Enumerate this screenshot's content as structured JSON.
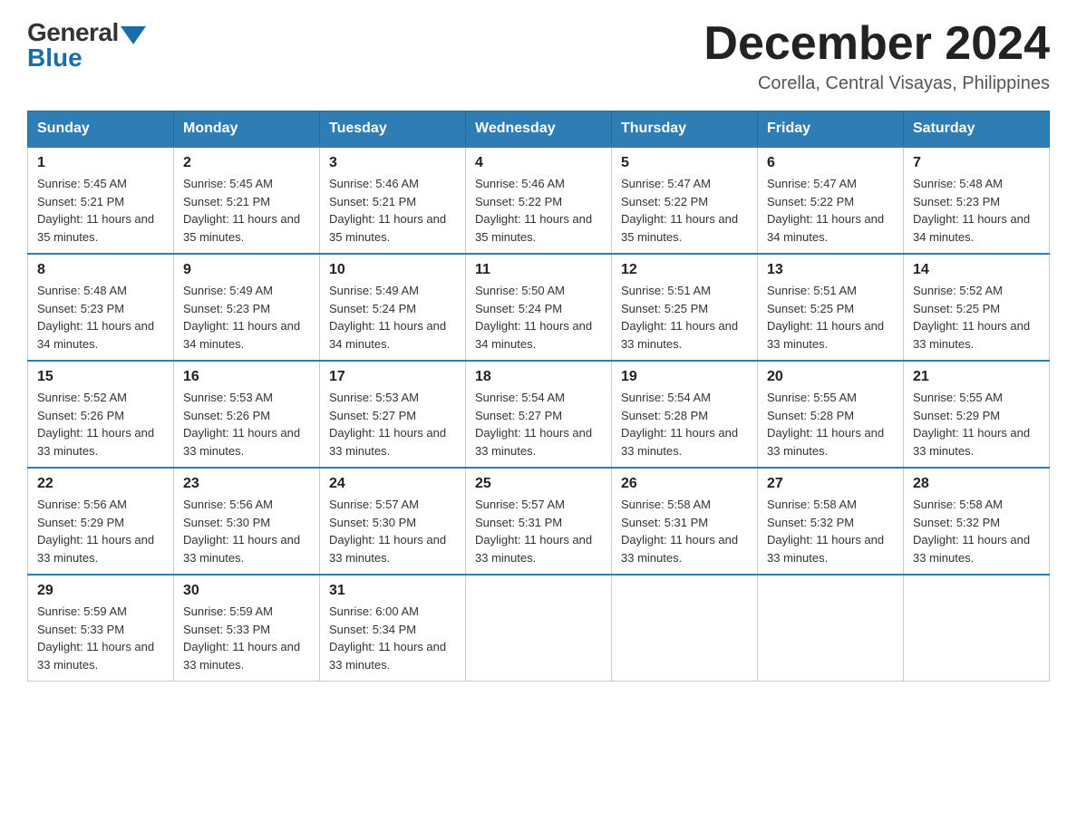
{
  "header": {
    "logo_general": "General",
    "logo_blue": "Blue",
    "month_title": "December 2024",
    "location": "Corella, Central Visayas, Philippines"
  },
  "days_of_week": [
    "Sunday",
    "Monday",
    "Tuesday",
    "Wednesday",
    "Thursday",
    "Friday",
    "Saturday"
  ],
  "weeks": [
    [
      {
        "day": "1",
        "sunrise": "5:45 AM",
        "sunset": "5:21 PM",
        "daylight": "11 hours and 35 minutes."
      },
      {
        "day": "2",
        "sunrise": "5:45 AM",
        "sunset": "5:21 PM",
        "daylight": "11 hours and 35 minutes."
      },
      {
        "day": "3",
        "sunrise": "5:46 AM",
        "sunset": "5:21 PM",
        "daylight": "11 hours and 35 minutes."
      },
      {
        "day": "4",
        "sunrise": "5:46 AM",
        "sunset": "5:22 PM",
        "daylight": "11 hours and 35 minutes."
      },
      {
        "day": "5",
        "sunrise": "5:47 AM",
        "sunset": "5:22 PM",
        "daylight": "11 hours and 35 minutes."
      },
      {
        "day": "6",
        "sunrise": "5:47 AM",
        "sunset": "5:22 PM",
        "daylight": "11 hours and 34 minutes."
      },
      {
        "day": "7",
        "sunrise": "5:48 AM",
        "sunset": "5:23 PM",
        "daylight": "11 hours and 34 minutes."
      }
    ],
    [
      {
        "day": "8",
        "sunrise": "5:48 AM",
        "sunset": "5:23 PM",
        "daylight": "11 hours and 34 minutes."
      },
      {
        "day": "9",
        "sunrise": "5:49 AM",
        "sunset": "5:23 PM",
        "daylight": "11 hours and 34 minutes."
      },
      {
        "day": "10",
        "sunrise": "5:49 AM",
        "sunset": "5:24 PM",
        "daylight": "11 hours and 34 minutes."
      },
      {
        "day": "11",
        "sunrise": "5:50 AM",
        "sunset": "5:24 PM",
        "daylight": "11 hours and 34 minutes."
      },
      {
        "day": "12",
        "sunrise": "5:51 AM",
        "sunset": "5:25 PM",
        "daylight": "11 hours and 33 minutes."
      },
      {
        "day": "13",
        "sunrise": "5:51 AM",
        "sunset": "5:25 PM",
        "daylight": "11 hours and 33 minutes."
      },
      {
        "day": "14",
        "sunrise": "5:52 AM",
        "sunset": "5:25 PM",
        "daylight": "11 hours and 33 minutes."
      }
    ],
    [
      {
        "day": "15",
        "sunrise": "5:52 AM",
        "sunset": "5:26 PM",
        "daylight": "11 hours and 33 minutes."
      },
      {
        "day": "16",
        "sunrise": "5:53 AM",
        "sunset": "5:26 PM",
        "daylight": "11 hours and 33 minutes."
      },
      {
        "day": "17",
        "sunrise": "5:53 AM",
        "sunset": "5:27 PM",
        "daylight": "11 hours and 33 minutes."
      },
      {
        "day": "18",
        "sunrise": "5:54 AM",
        "sunset": "5:27 PM",
        "daylight": "11 hours and 33 minutes."
      },
      {
        "day": "19",
        "sunrise": "5:54 AM",
        "sunset": "5:28 PM",
        "daylight": "11 hours and 33 minutes."
      },
      {
        "day": "20",
        "sunrise": "5:55 AM",
        "sunset": "5:28 PM",
        "daylight": "11 hours and 33 minutes."
      },
      {
        "day": "21",
        "sunrise": "5:55 AM",
        "sunset": "5:29 PM",
        "daylight": "11 hours and 33 minutes."
      }
    ],
    [
      {
        "day": "22",
        "sunrise": "5:56 AM",
        "sunset": "5:29 PM",
        "daylight": "11 hours and 33 minutes."
      },
      {
        "day": "23",
        "sunrise": "5:56 AM",
        "sunset": "5:30 PM",
        "daylight": "11 hours and 33 minutes."
      },
      {
        "day": "24",
        "sunrise": "5:57 AM",
        "sunset": "5:30 PM",
        "daylight": "11 hours and 33 minutes."
      },
      {
        "day": "25",
        "sunrise": "5:57 AM",
        "sunset": "5:31 PM",
        "daylight": "11 hours and 33 minutes."
      },
      {
        "day": "26",
        "sunrise": "5:58 AM",
        "sunset": "5:31 PM",
        "daylight": "11 hours and 33 minutes."
      },
      {
        "day": "27",
        "sunrise": "5:58 AM",
        "sunset": "5:32 PM",
        "daylight": "11 hours and 33 minutes."
      },
      {
        "day": "28",
        "sunrise": "5:58 AM",
        "sunset": "5:32 PM",
        "daylight": "11 hours and 33 minutes."
      }
    ],
    [
      {
        "day": "29",
        "sunrise": "5:59 AM",
        "sunset": "5:33 PM",
        "daylight": "11 hours and 33 minutes."
      },
      {
        "day": "30",
        "sunrise": "5:59 AM",
        "sunset": "5:33 PM",
        "daylight": "11 hours and 33 minutes."
      },
      {
        "day": "31",
        "sunrise": "6:00 AM",
        "sunset": "5:34 PM",
        "daylight": "11 hours and 33 minutes."
      },
      null,
      null,
      null,
      null
    ]
  ],
  "labels": {
    "sunrise_prefix": "Sunrise: ",
    "sunset_prefix": "Sunset: ",
    "daylight_prefix": "Daylight: "
  }
}
